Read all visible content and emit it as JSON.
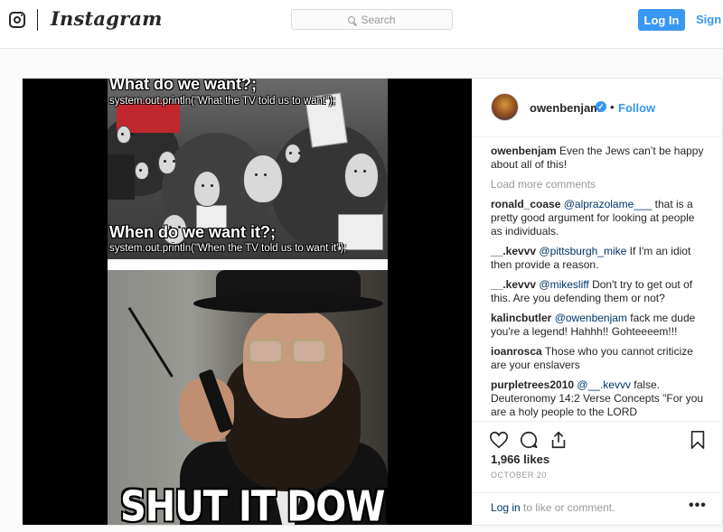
{
  "header": {
    "brand": "Instagram",
    "search_placeholder": "Search",
    "login_label": "Log In",
    "signup_label": "Sign"
  },
  "post": {
    "username": "owenbenjam",
    "follow_label": "Follow",
    "separator": "•",
    "caption": {
      "user": "owenbenjam",
      "text": "Even the Jews can’t be happy about all of this!"
    },
    "load_more": "Load more comments",
    "comments": [
      {
        "user": "ronald_coase",
        "mention": "@alprazolame___",
        "text": "that is a pretty good argument for looking at people as individuals."
      },
      {
        "user": "__.kevvv",
        "mention": "@pittsburgh_mike",
        "text": "If I'm an idiot then provide a reason."
      },
      {
        "user": "__.kevvv",
        "mention": "@mikesliff",
        "text": "Don't try to get out of this. Are you defending them or not?"
      },
      {
        "user": "kalincbutler",
        "mention": "@owenbenjam",
        "text": "fack me dude you're a legend! Hahhh!! Gohteeeem!!!"
      },
      {
        "user": "ioanrosca",
        "mention": "",
        "text": "Those who you cannot criticize are your enslavers"
      },
      {
        "user": "purpletrees2010",
        "mention": "@__.kevvv",
        "text": "false. Deuteronomy 14:2 Verse Concepts \"For you are a holy people to the LORD"
      }
    ],
    "likes": "1,966 likes",
    "date": "OCTOBER 20",
    "login_prompt": {
      "link": "Log in",
      "rest": " to like or comment."
    },
    "more_label": "•••"
  },
  "meme": {
    "line1": "What do we want?;",
    "line2": "system.out.println(\"What the TV told us to want\");",
    "line3": "When do we want it?;",
    "line4": "system.out.println(\"When the TV told us to want it\");",
    "bottom_caption": "SHUT IT DOWN"
  },
  "icons": [
    "instagram-glyph-icon",
    "search-icon",
    "verified-badge-icon",
    "heart-icon",
    "comment-icon",
    "share-icon",
    "bookmark-icon",
    "more-options-icon"
  ],
  "colors": {
    "accent": "#3897f0",
    "link": "#003569",
    "muted": "#999999"
  }
}
